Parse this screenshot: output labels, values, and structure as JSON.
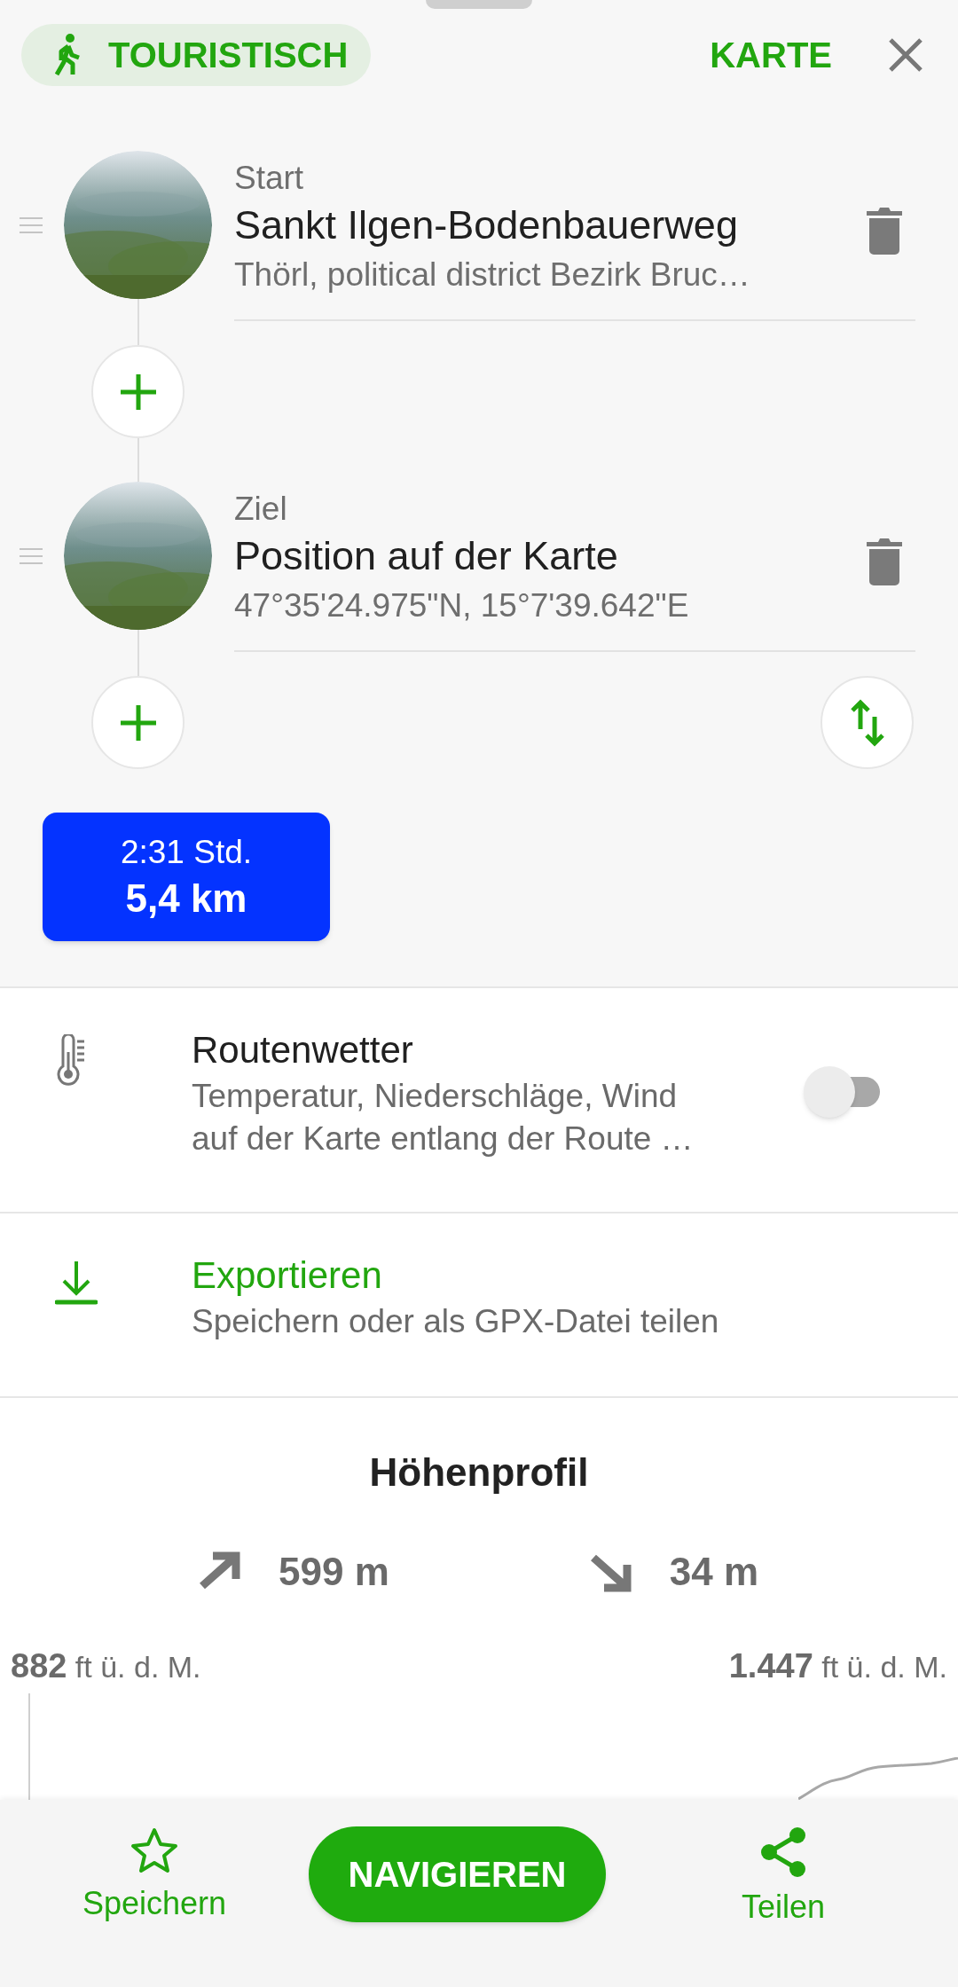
{
  "header": {
    "mode_chip": "TOURISTISCH",
    "map_button": "KARTE"
  },
  "waypoints": [
    {
      "label": "Start",
      "name": "Sankt Ilgen-Bodenbauerweg",
      "detail": "Thörl, political district Bezirk Bruc…"
    },
    {
      "label": "Ziel",
      "name": "Position auf der Karte",
      "detail": "47°35'24.975\"N, 15°7'39.642\"E"
    }
  ],
  "summary": {
    "duration": "2:31 Std.",
    "distance": "5,4 km"
  },
  "options": [
    {
      "kind": "toggle",
      "title": "Routenwetter",
      "subtitle": "Temperatur, Niederschläge, Wind auf der Karte entlang der Route …",
      "on": false
    },
    {
      "kind": "action",
      "title": "Exportieren",
      "subtitle": "Speichern oder als GPX-Datei teilen"
    }
  ],
  "elevation": {
    "title": "Höhenprofil",
    "ascent": "599 m",
    "descent": "34 m",
    "min_label": "**882** ft ü. d. M.",
    "max_label": "**1.447** ft ü. d. M."
  },
  "bottom_bar": {
    "save": "Speichern",
    "navigate": "NAVIGIEREN",
    "share": "Teilen"
  }
}
